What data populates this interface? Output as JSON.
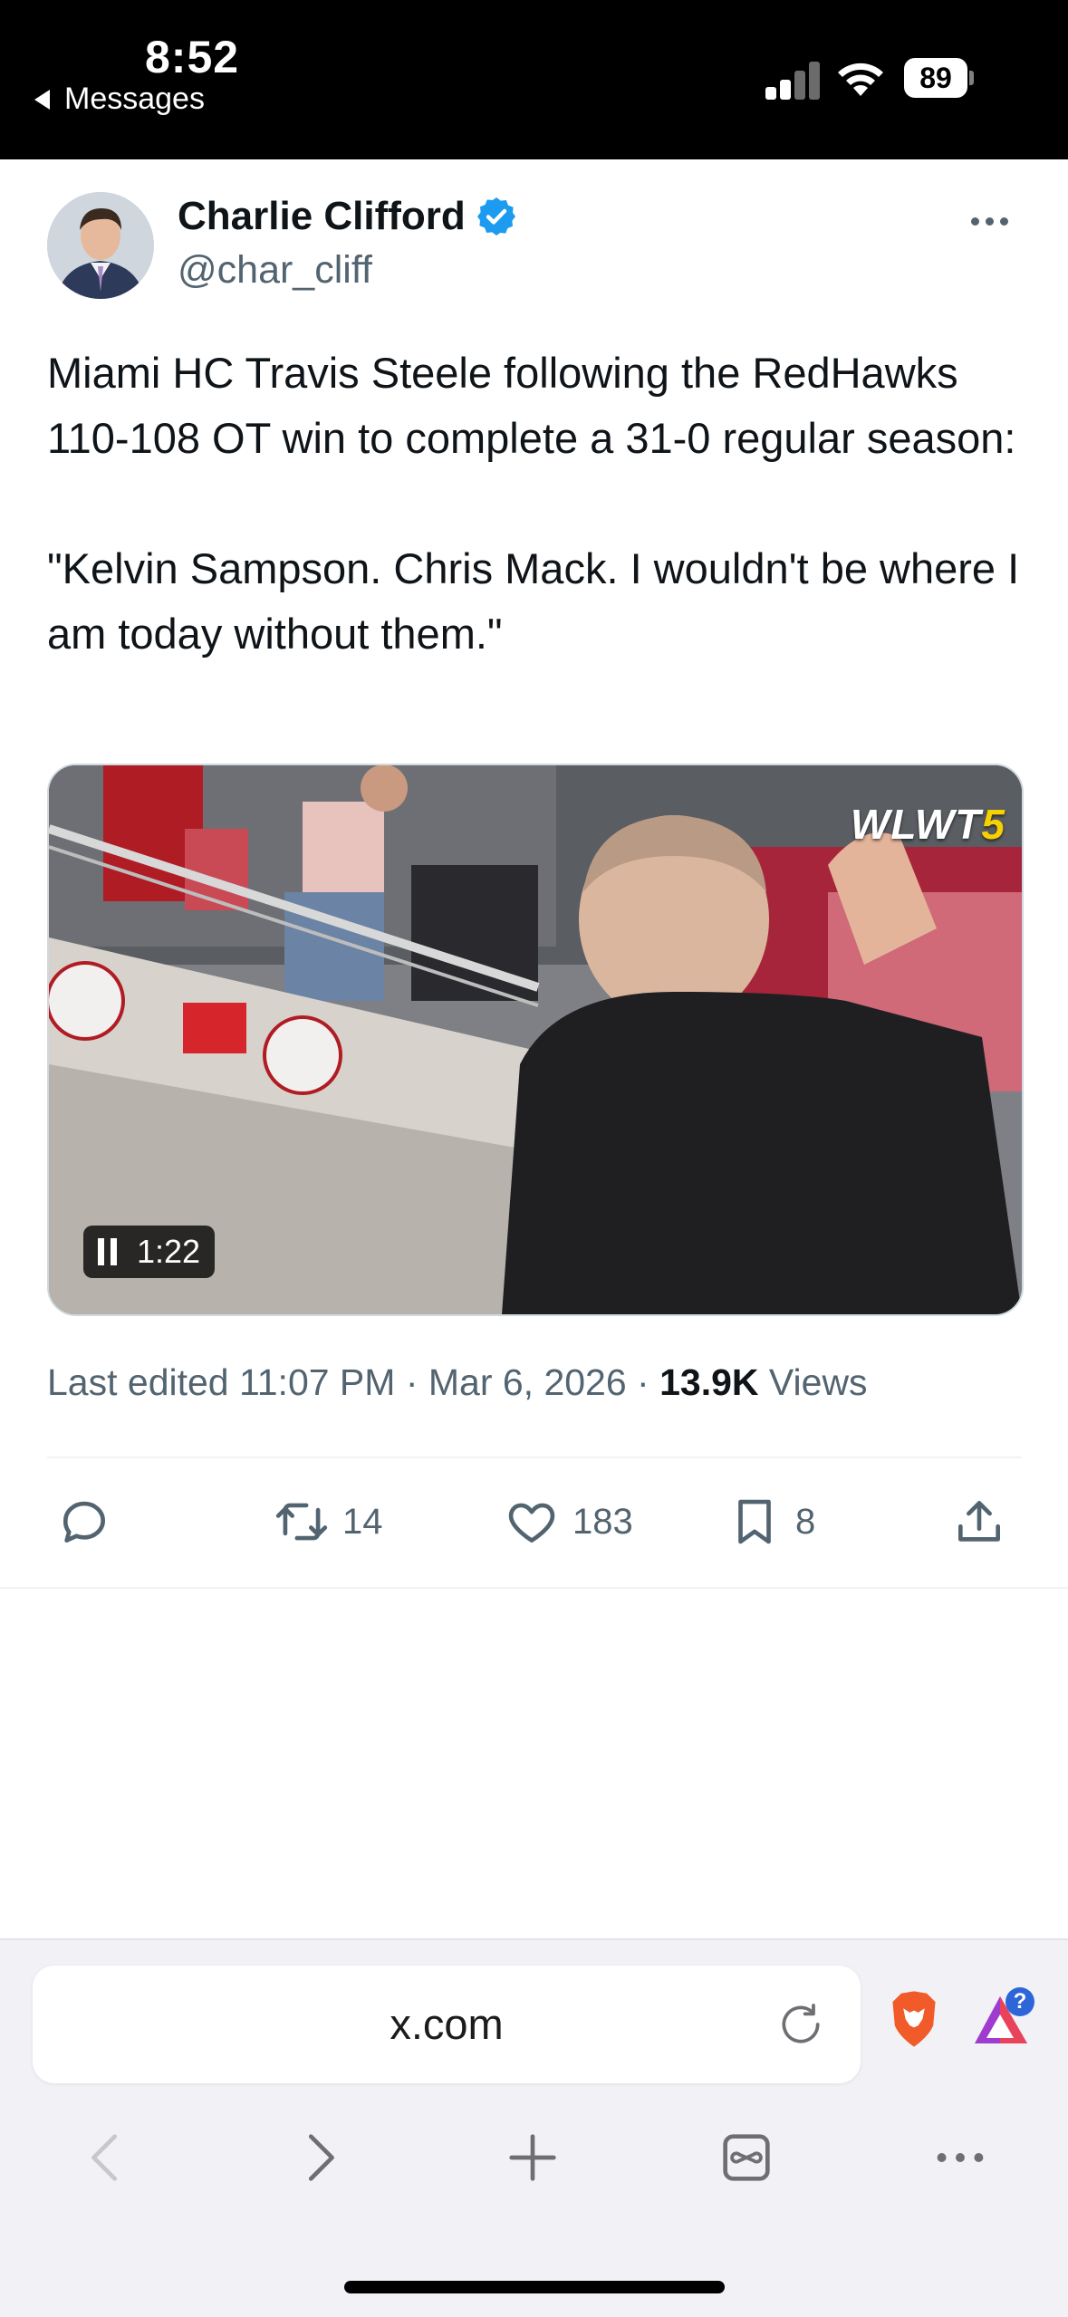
{
  "status_bar": {
    "time": "8:52",
    "back_label": "Messages",
    "battery": "89"
  },
  "tweet": {
    "author_name": "Charlie Clifford",
    "handle": "@char_cliff",
    "text": "Miami HC Travis Steele following the RedHawks 110-108 OT win to complete a 31-0 regular season:\n\n\"Kelvin Sampson. Chris Mack. I wouldn't be where I am today without them.\"",
    "media": {
      "watermark_main": "WLWT",
      "watermark_num": "5",
      "duration": "1:22"
    },
    "meta": {
      "edited": "Last edited 11:07 PM · Mar 6, 2026 · ",
      "views_count": "13.9K",
      "views_label": " Views"
    },
    "actions": {
      "retweets": "14",
      "likes": "183",
      "bookmarks": "8"
    }
  },
  "browser": {
    "url": "x.com",
    "rewards_badge": "?"
  },
  "colors": {
    "verified": "#1d9bf0",
    "muted": "#536471",
    "text": "#0f1419"
  },
  "icons": [
    "reply-icon",
    "retweet-icon",
    "like-icon",
    "bookmark-icon",
    "share-icon",
    "reload-icon",
    "brave-lion-icon",
    "brave-rewards-icon",
    "back-icon",
    "forward-icon",
    "new-tab-icon",
    "tabs-icon",
    "menu-icon"
  ]
}
